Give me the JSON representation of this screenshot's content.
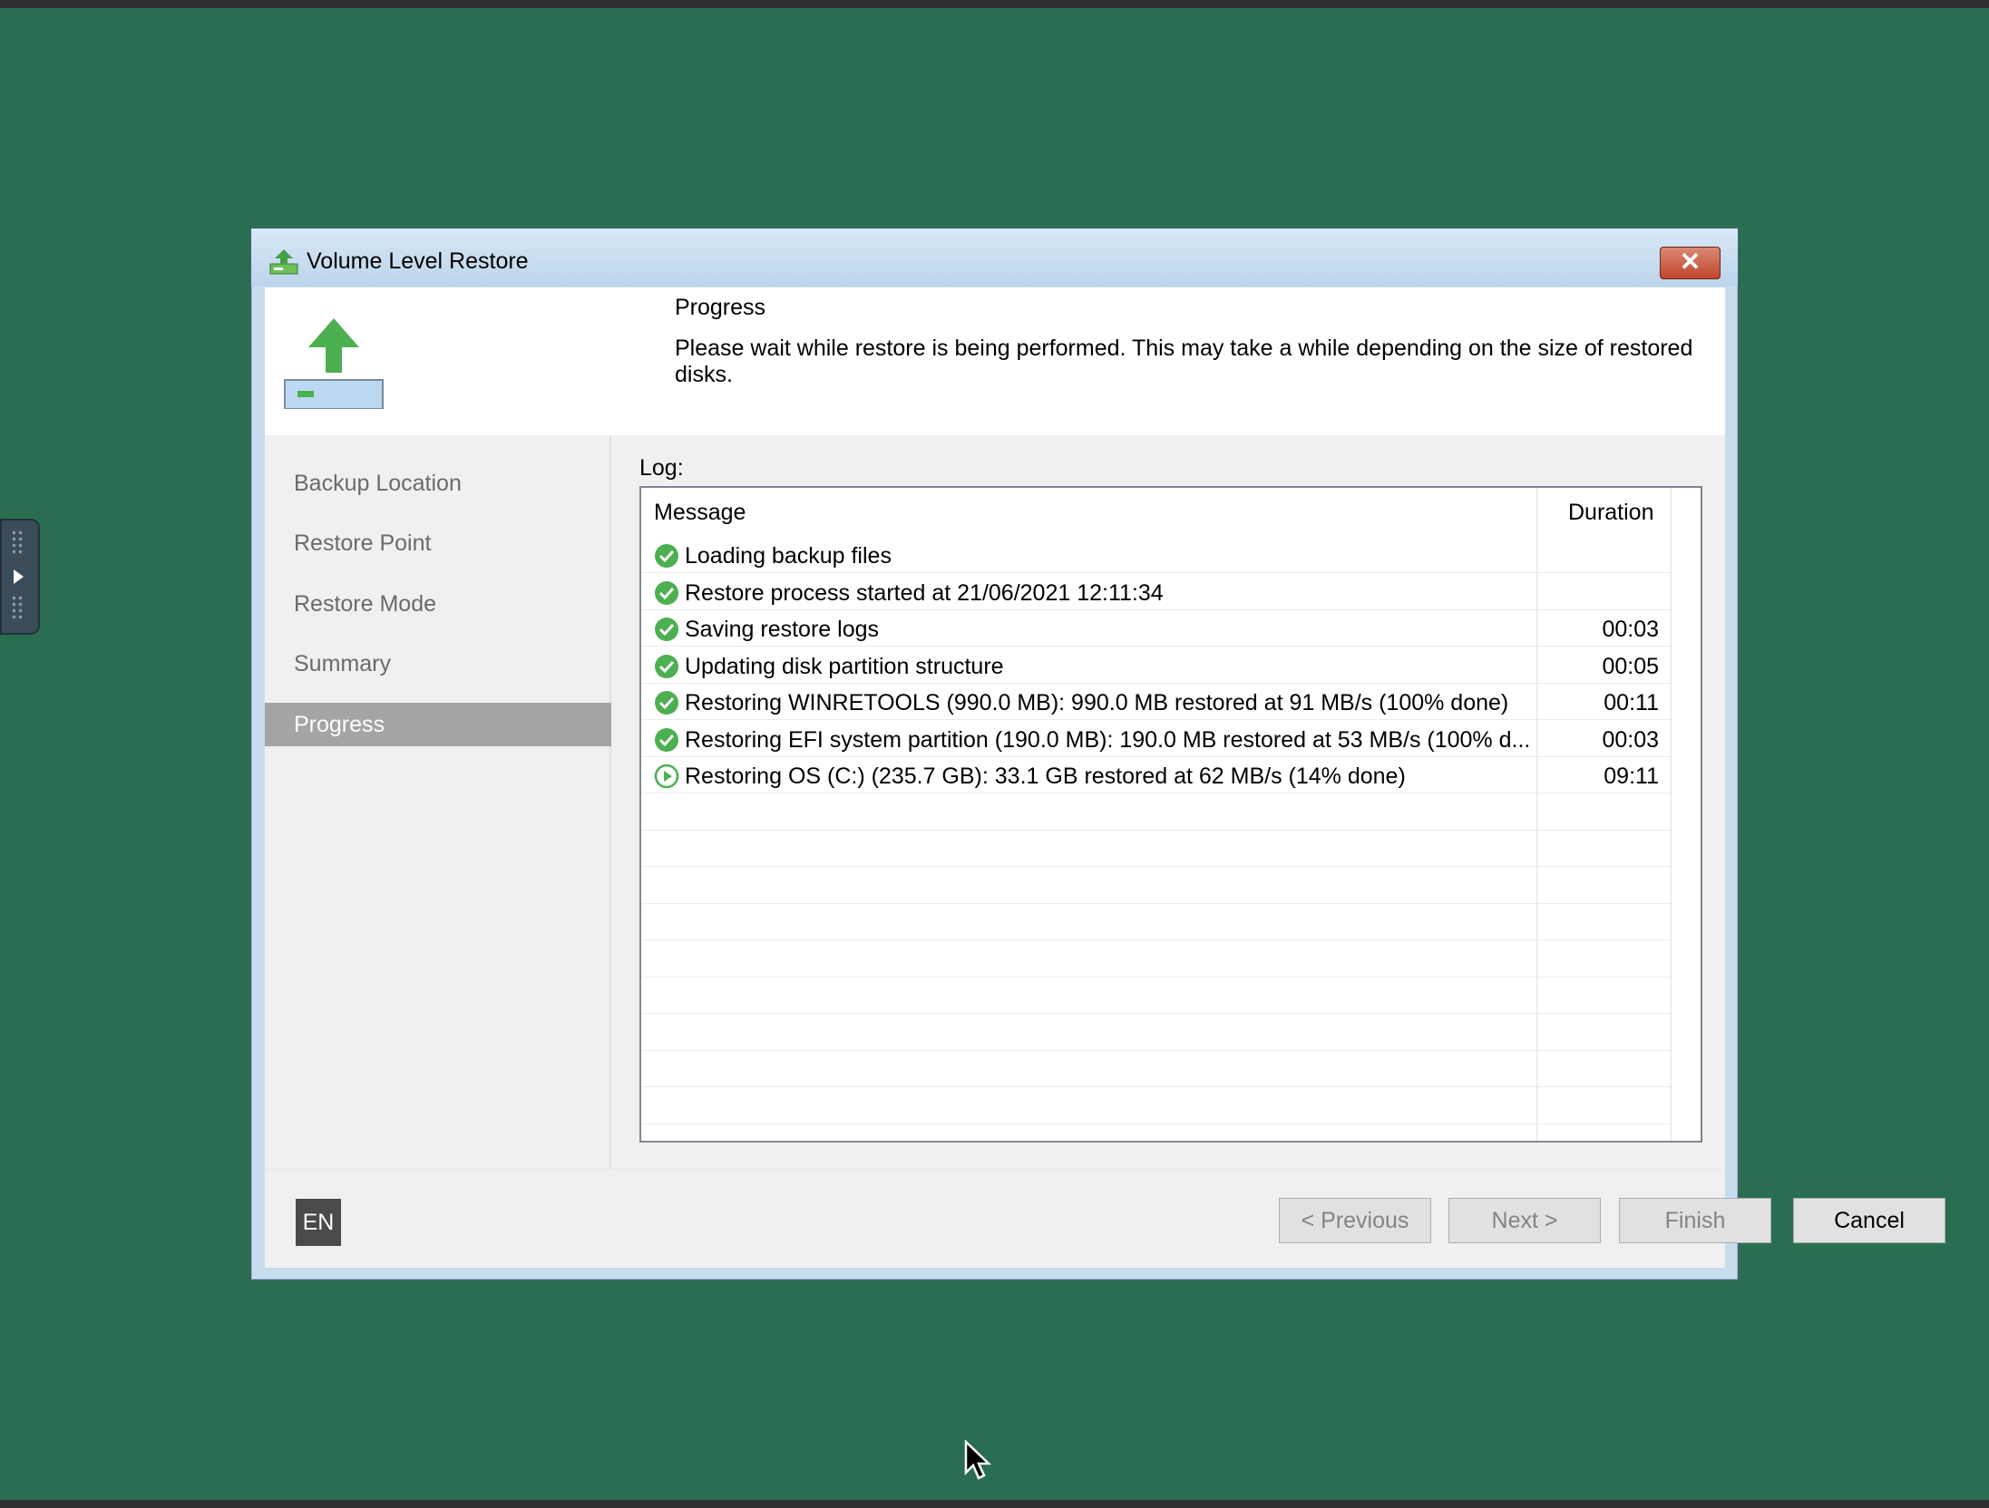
{
  "window": {
    "title": "Volume Level Restore",
    "close_label": "✕"
  },
  "header": {
    "title": "Progress",
    "description": "Please wait while restore is being performed. This may take a while depending on the size of restored disks."
  },
  "nav": {
    "items": [
      {
        "label": "Backup Location",
        "active": false
      },
      {
        "label": "Restore Point",
        "active": false
      },
      {
        "label": "Restore Mode",
        "active": false
      },
      {
        "label": "Summary",
        "active": false
      },
      {
        "label": "Progress",
        "active": true
      }
    ]
  },
  "log": {
    "label": "Log:",
    "columns": {
      "message": "Message",
      "duration": "Duration"
    },
    "rows": [
      {
        "status": "success",
        "icon": "check-circle-icon",
        "message": "Loading backup files",
        "duration": ""
      },
      {
        "status": "success",
        "icon": "check-circle-icon",
        "message": "Restore process started at 21/06/2021 12:11:34",
        "duration": ""
      },
      {
        "status": "success",
        "icon": "check-circle-icon",
        "message": "Saving restore logs",
        "duration": "00:03"
      },
      {
        "status": "success",
        "icon": "check-circle-icon",
        "message": "Updating disk partition structure",
        "duration": "00:05"
      },
      {
        "status": "success",
        "icon": "check-circle-icon",
        "message": "Restoring WINRETOOLS (990.0 MB): 990.0 MB restored at 91 MB/s (100% done)",
        "duration": "00:11"
      },
      {
        "status": "success",
        "icon": "check-circle-icon",
        "message": "Restoring EFI system partition (190.0 MB): 190.0 MB restored at 53 MB/s (100% d...",
        "duration": "00:03"
      },
      {
        "status": "running",
        "icon": "play-circle-icon",
        "message": "Restoring OS (C:) (235.7 GB): 33.1 GB restored at 62 MB/s (14% done)",
        "duration": "09:11"
      }
    ],
    "empty_rows": 9
  },
  "footer": {
    "language": "EN",
    "previous_label": "< Previous",
    "next_label": "Next >",
    "finish_label": "Finish",
    "cancel_label": "Cancel"
  },
  "colors": {
    "desktop": "#2a6e52",
    "success": "#4caf50",
    "active_nav": "#a4a4a4"
  }
}
